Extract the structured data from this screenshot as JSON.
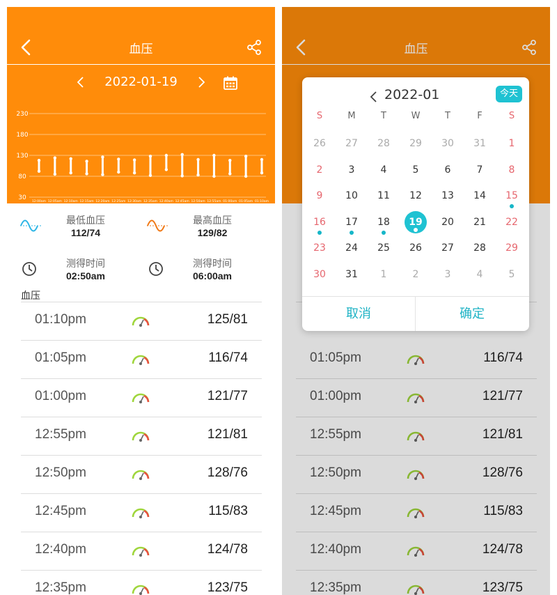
{
  "header": {
    "title": "血压"
  },
  "date_nav": {
    "date": "2022-01-19"
  },
  "chart_data": {
    "type": "bar",
    "yticks": [
      230,
      180,
      130,
      80,
      30
    ],
    "ylim": [
      30,
      230
    ],
    "categories": [
      "12:00am",
      "12:05am",
      "12:10am",
      "12:15am",
      "12:20am",
      "12:25am",
      "12:30am",
      "12:35am",
      "12:40am",
      "12:45am",
      "12:50am",
      "12:55am",
      "01:00am",
      "01:05am",
      "01:10am"
    ],
    "series": [
      {
        "values_low": [
          92,
          85,
          88,
          86,
          84,
          90,
          88,
          82,
          96,
          81,
          83,
          80,
          86,
          80,
          88
        ]
      },
      {
        "values_high": [
          118,
          124,
          122,
          116,
          126,
          121,
          119,
          128,
          130,
          132,
          120,
          130,
          118,
          128,
          120
        ]
      }
    ],
    "colors": {
      "background": "#ff8c0a",
      "bar": "#ffffff",
      "grid": "#ffc27a"
    }
  },
  "summary": {
    "lowest": {
      "label": "最低血压",
      "value": "112/74",
      "icon": "wave-blue-icon"
    },
    "highest": {
      "label": "最高血压",
      "value": "129/82",
      "icon": "wave-orange-icon"
    },
    "time1": {
      "label": "测得时间",
      "value": "02:50am",
      "icon": "clock-icon"
    },
    "time2": {
      "label": "测得时间",
      "value": "06:00am",
      "icon": "clock-icon"
    }
  },
  "list": {
    "section_title": "血压",
    "rows_left": [
      {
        "time": "01:10pm",
        "value": "125/81"
      },
      {
        "time": "01:05pm",
        "value": "116/74"
      },
      {
        "time": "01:00pm",
        "value": "121/77"
      },
      {
        "time": "12:55pm",
        "value": "121/81"
      },
      {
        "time": "12:50pm",
        "value": "128/76"
      },
      {
        "time": "12:45pm",
        "value": "115/83"
      },
      {
        "time": "12:40pm",
        "value": "124/78"
      },
      {
        "time": "12:35pm",
        "value": "123/75"
      }
    ]
  },
  "calendar": {
    "month": "2022-01",
    "today_label": "今天",
    "weekdays": [
      "S",
      "M",
      "T",
      "W",
      "T",
      "F",
      "S"
    ],
    "days": [
      [
        "26",
        "27",
        "28",
        "29",
        "30",
        "31",
        "1"
      ],
      [
        "2",
        "3",
        "4",
        "5",
        "6",
        "7",
        "8"
      ],
      [
        "9",
        "10",
        "11",
        "12",
        "13",
        "14",
        "15"
      ],
      [
        "16",
        "17",
        "18",
        "19",
        "20",
        "21",
        "22"
      ],
      [
        "23",
        "24",
        "25",
        "26",
        "27",
        "28",
        "29"
      ],
      [
        "30",
        "31",
        "1",
        "2",
        "3",
        "4",
        "5"
      ]
    ],
    "selected_day": "19",
    "dotted_days": [
      "15",
      "16",
      "17",
      "18",
      "19"
    ],
    "cancel_label": "取消",
    "confirm_label": "确定",
    "accent": "#1fc2d2",
    "weekend_color": "#e6666e"
  }
}
